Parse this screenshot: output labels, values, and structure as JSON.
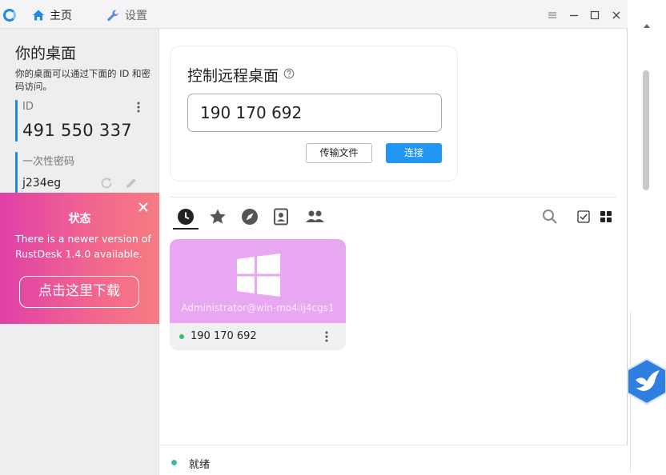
{
  "titlebar": {
    "home_label": "主页",
    "settings_label": "设置"
  },
  "left": {
    "title": "你的桌面",
    "description": "你的桌面可以通过下面的 ID 和密码访问。",
    "id_label": "ID",
    "id_value": "491 550 337",
    "password_label": "一次性密码",
    "password_value": "j234eg"
  },
  "promo": {
    "title": "状态",
    "message": "There is a newer version of RustDesk 1.4.0 available.",
    "button": "点击这里下载",
    "gradient_colors": [
      "#e040a8",
      "#f57c82"
    ]
  },
  "connect": {
    "title": "控制远程桌面",
    "input_value": "190 170 692",
    "transfer_label": "传输文件",
    "connect_label": "连接",
    "accent": "#2196f3"
  },
  "peer_tabs": [
    "recent-clock-icon",
    "favorites-star-icon",
    "discovered-compass-icon",
    "address-book-icon",
    "group-icon"
  ],
  "peers": [
    {
      "username": "Administrator@win-mo4iij4cgs1",
      "id": "190 170 692",
      "online": true,
      "thumb_color": "#e7a7f1"
    }
  ],
  "status": {
    "text": "就绪"
  }
}
